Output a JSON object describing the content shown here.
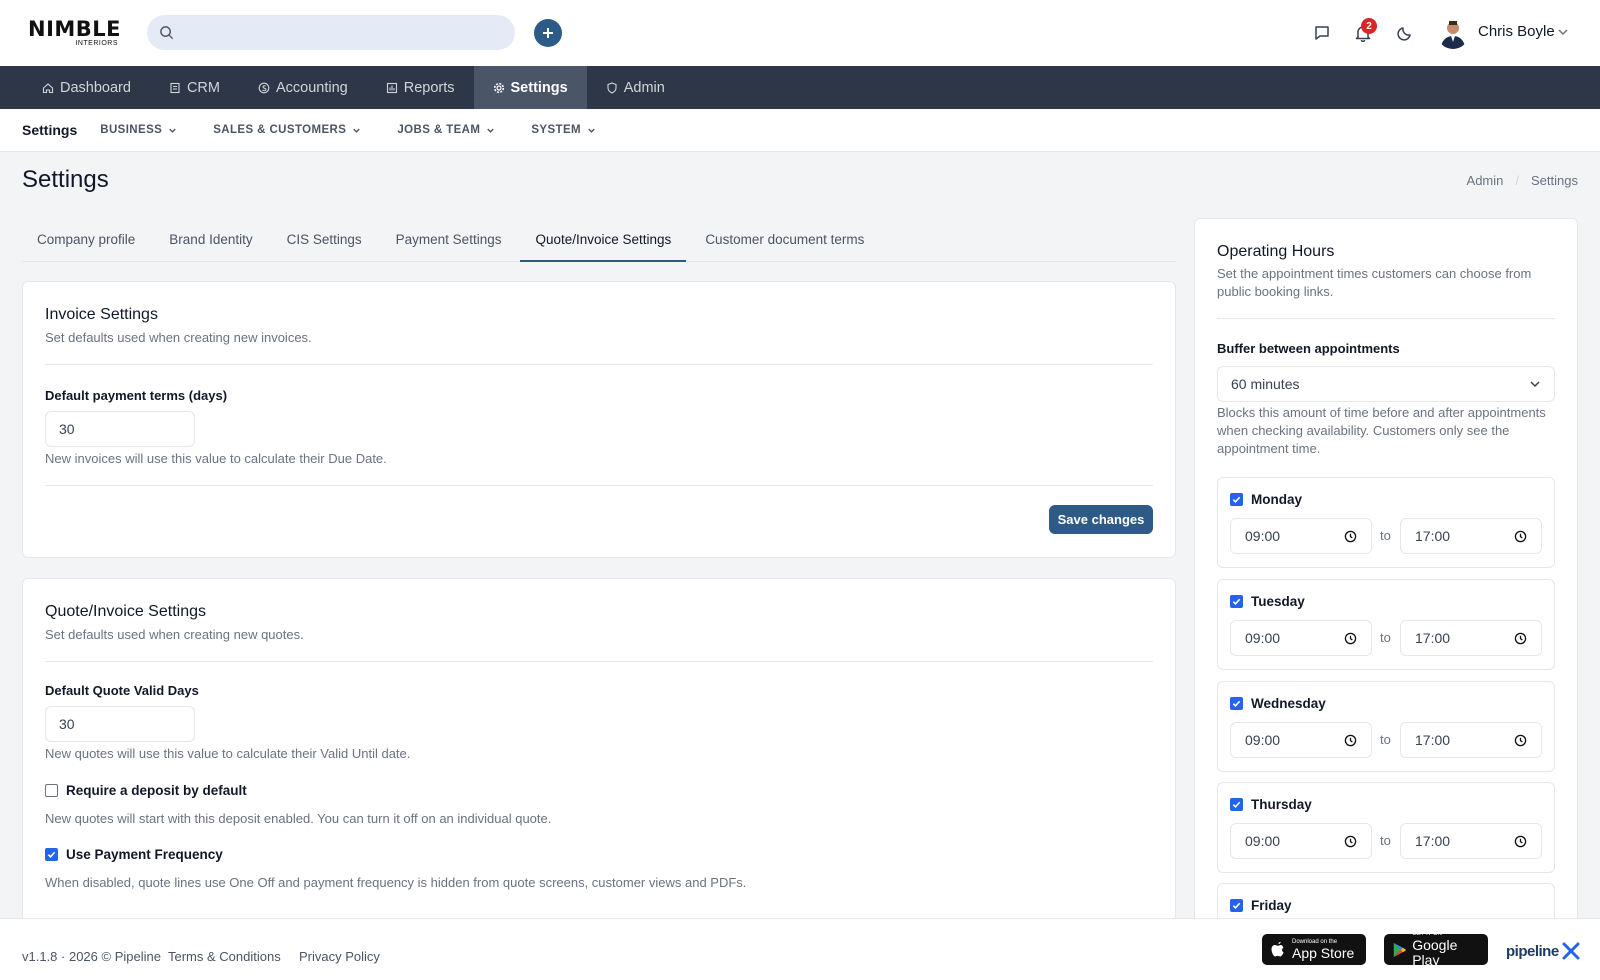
{
  "brand": {
    "name": "NIMBLE",
    "sub": "INTERIORS"
  },
  "header": {
    "notifications_count": "2",
    "user_name": "Chris Boyle"
  },
  "nav": [
    {
      "label": "Dashboard",
      "icon": "home-icon"
    },
    {
      "label": "CRM",
      "icon": "crm-icon"
    },
    {
      "label": "Accounting",
      "icon": "accounting-icon"
    },
    {
      "label": "Reports",
      "icon": "reports-icon"
    },
    {
      "label": "Settings",
      "icon": "gear-icon",
      "active": true
    },
    {
      "label": "Admin",
      "icon": "shield-icon"
    }
  ],
  "subnav": {
    "title": "Settings",
    "items": [
      "BUSINESS",
      "SALES & CUSTOMERS",
      "JOBS & TEAM",
      "SYSTEM"
    ]
  },
  "page": {
    "title": "Settings",
    "breadcrumb": [
      "Admin",
      "Settings"
    ]
  },
  "tabs": [
    "Company profile",
    "Brand Identity",
    "CIS Settings",
    "Payment Settings",
    "Quote/Invoice Settings",
    "Customer document terms"
  ],
  "invoice": {
    "title": "Invoice Settings",
    "subtitle": "Set defaults used when creating new invoices.",
    "terms_label": "Default payment terms (days)",
    "terms_value": "30",
    "terms_help": "New invoices will use this value to calculate their Due Date.",
    "save_label": "Save changes"
  },
  "quote": {
    "title": "Quote/Invoice Settings",
    "subtitle": "Set defaults used when creating new quotes.",
    "valid_label": "Default Quote Valid Days",
    "valid_value": "30",
    "valid_help": "New quotes will use this value to calculate their Valid Until date.",
    "deposit_label": "Require a deposit by default",
    "deposit_checked": false,
    "deposit_help": "New quotes will start with this deposit enabled. You can turn it off on an individual quote.",
    "freq_label": "Use Payment Frequency",
    "freq_checked": true,
    "freq_help": "When disabled, quote lines use One Off and payment frequency is hidden from quote screens, customer views and PDFs."
  },
  "hours": {
    "title": "Operating Hours",
    "subtitle": "Set the appointment times customers can choose from public booking links.",
    "buffer_label": "Buffer between appointments",
    "buffer_value": "60 minutes",
    "buffer_help": "Blocks this amount of time before and after appointments when checking availability. Customers only see the appointment time.",
    "to_label": "to",
    "days": [
      {
        "name": "Monday",
        "checked": true,
        "from": "09:00",
        "to": "17:00"
      },
      {
        "name": "Tuesday",
        "checked": true,
        "from": "09:00",
        "to": "17:00"
      },
      {
        "name": "Wednesday",
        "checked": true,
        "from": "09:00",
        "to": "17:00"
      },
      {
        "name": "Thursday",
        "checked": true,
        "from": "09:00",
        "to": "17:00"
      },
      {
        "name": "Friday",
        "checked": true
      }
    ]
  },
  "footer": {
    "version": "v1.1.8 · 2026 © Pipeline",
    "terms": "Terms & Conditions",
    "privacy": "Privacy Policy",
    "appstore_small": "Download on the",
    "appstore_big": "App Store",
    "play_small": "GET IT ON",
    "play_big": "Google Play",
    "pipeline_logo": "pipeline"
  },
  "colors": {
    "primary": "#2e5a87",
    "nav_bg": "#2d3748",
    "badge": "#dc2626",
    "checkbox": "#2563eb"
  }
}
